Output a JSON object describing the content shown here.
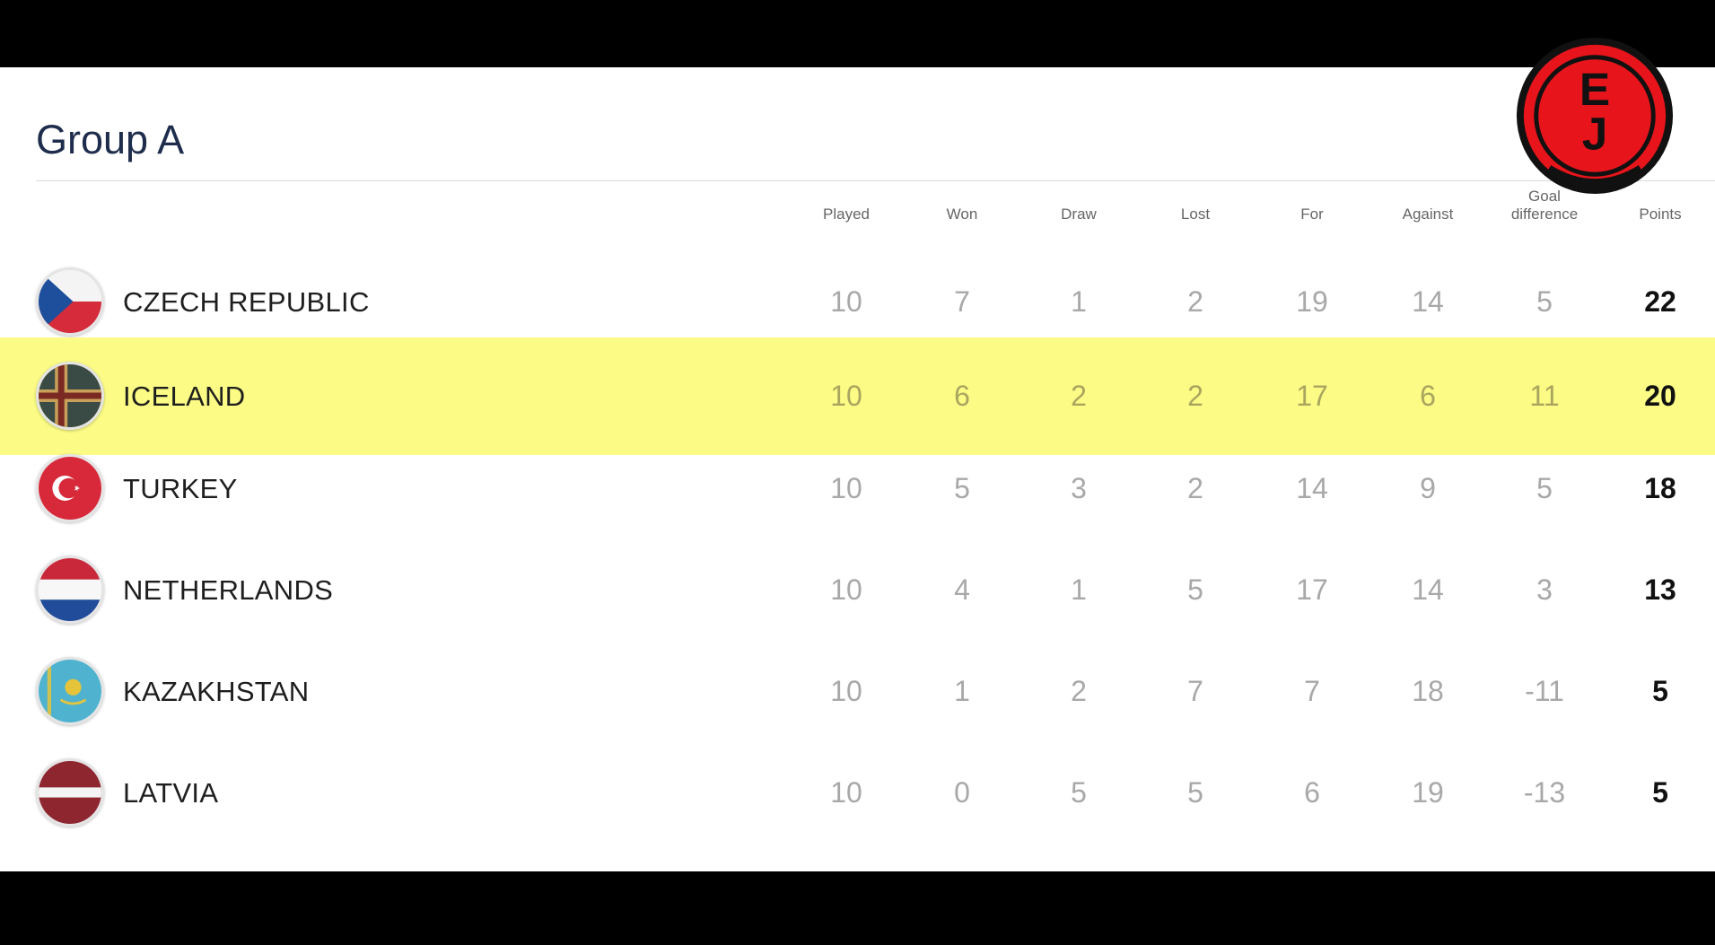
{
  "group": {
    "title": "Group A"
  },
  "columns": [
    "Played",
    "Won",
    "Draw",
    "Lost",
    "For",
    "Against",
    "Goal difference",
    "Points"
  ],
  "column_lines": [
    [
      "Played"
    ],
    [
      "Won"
    ],
    [
      "Draw"
    ],
    [
      "Lost"
    ],
    [
      "For"
    ],
    [
      "Against"
    ],
    [
      "Goal",
      "difference"
    ],
    [
      "Points"
    ]
  ],
  "rows": [
    {
      "team": "CZECH REPUBLIC",
      "flag": "czech-flag",
      "played": "10",
      "won": "7",
      "draw": "1",
      "lost": "2",
      "for": "19",
      "against": "14",
      "gd": "5",
      "points": "22",
      "highlighted": false
    },
    {
      "team": "ICELAND",
      "flag": "iceland-flag",
      "played": "10",
      "won": "6",
      "draw": "2",
      "lost": "2",
      "for": "17",
      "against": "6",
      "gd": "11",
      "points": "20",
      "highlighted": true
    },
    {
      "team": "TURKEY",
      "flag": "turkey-flag",
      "played": "10",
      "won": "5",
      "draw": "3",
      "lost": "2",
      "for": "14",
      "against": "9",
      "gd": "5",
      "points": "18",
      "highlighted": false
    },
    {
      "team": "NETHERLANDS",
      "flag": "netherlands-flag",
      "played": "10",
      "won": "4",
      "draw": "1",
      "lost": "5",
      "for": "17",
      "against": "14",
      "gd": "3",
      "points": "13",
      "highlighted": false
    },
    {
      "team": "KAZAKHSTAN",
      "flag": "kazakhstan-flag",
      "played": "10",
      "won": "1",
      "draw": "2",
      "lost": "7",
      "for": "7",
      "against": "18",
      "gd": "-11",
      "points": "5",
      "highlighted": false
    },
    {
      "team": "LATVIA",
      "flag": "latvia-flag",
      "played": "10",
      "won": "0",
      "draw": "5",
      "lost": "5",
      "for": "6",
      "against": "19",
      "gd": "-13",
      "points": "5",
      "highlighted": false
    }
  ],
  "logo": {
    "letters": "EJ",
    "icon": "ej-logo-badge"
  },
  "colors": {
    "highlight": "#fbfb85",
    "title": "#1f2d4d",
    "stat": "#a8a8a8",
    "points": "#111111",
    "logo_red": "#e8141b"
  }
}
